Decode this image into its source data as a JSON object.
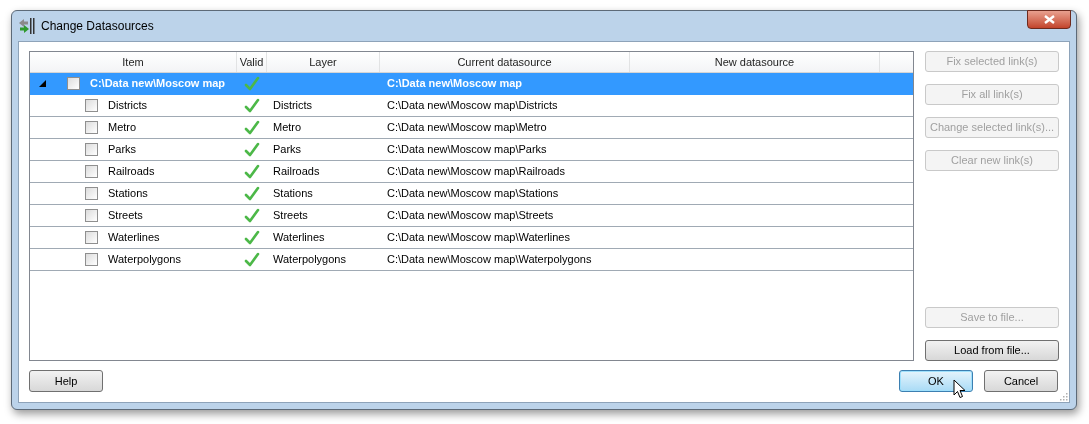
{
  "window": {
    "title": "Change Datasources"
  },
  "table": {
    "columns": [
      "Item",
      "Valid",
      "Layer",
      "Current datasource",
      "New datasource"
    ],
    "rows": [
      {
        "item": "C:\\Data new\\Moscow map",
        "valid": true,
        "checked": false,
        "selected": true,
        "expanded": true,
        "current_datasource": "C:\\Data new\\Moscow map",
        "children": [
          {
            "item": "Districts",
            "valid": true,
            "checked": false,
            "selected": false,
            "layer": "Districts",
            "current_datasource": "C:\\Data new\\Moscow map\\Districts"
          },
          {
            "item": "Metro",
            "valid": true,
            "checked": false,
            "selected": false,
            "layer": "Metro",
            "current_datasource": "C:\\Data new\\Moscow map\\Metro"
          },
          {
            "item": "Parks",
            "valid": true,
            "checked": false,
            "selected": false,
            "layer": "Parks",
            "current_datasource": "C:\\Data new\\Moscow map\\Parks"
          },
          {
            "item": "Railroads",
            "valid": true,
            "checked": false,
            "selected": false,
            "layer": "Railroads",
            "current_datasource": "C:\\Data new\\Moscow map\\Railroads"
          },
          {
            "item": "Stations",
            "valid": true,
            "checked": false,
            "selected": false,
            "layer": "Stations",
            "current_datasource": "C:\\Data new\\Moscow map\\Stations"
          },
          {
            "item": "Streets",
            "valid": true,
            "checked": false,
            "selected": false,
            "layer": "Streets",
            "current_datasource": "C:\\Data new\\Moscow map\\Streets"
          },
          {
            "item": "Waterlines",
            "valid": true,
            "checked": false,
            "selected": false,
            "layer": "Waterlines",
            "current_datasource": "C:\\Data new\\Moscow map\\Waterlines"
          },
          {
            "item": "Waterpolygons",
            "valid": true,
            "checked": false,
            "selected": false,
            "layer": "Waterpolygons",
            "current_datasource": "C:\\Data new\\Moscow map\\Waterpolygons"
          }
        ]
      }
    ]
  },
  "side_buttons_top": [
    {
      "label": "Fix selected link(s)",
      "disabled": true
    },
    {
      "label": "Fix all link(s)",
      "disabled": true
    },
    {
      "label": "Change selected link(s)...",
      "disabled": true
    },
    {
      "label": "Clear new link(s)",
      "disabled": true
    }
  ],
  "side_buttons_bottom": [
    {
      "label": "Save to file...",
      "disabled": true
    },
    {
      "label": "Load from file...",
      "disabled": false
    }
  ],
  "help_button": "Help",
  "dialog_buttons": [
    {
      "label": "OK",
      "default": true
    },
    {
      "label": "Cancel",
      "default": false
    }
  ]
}
